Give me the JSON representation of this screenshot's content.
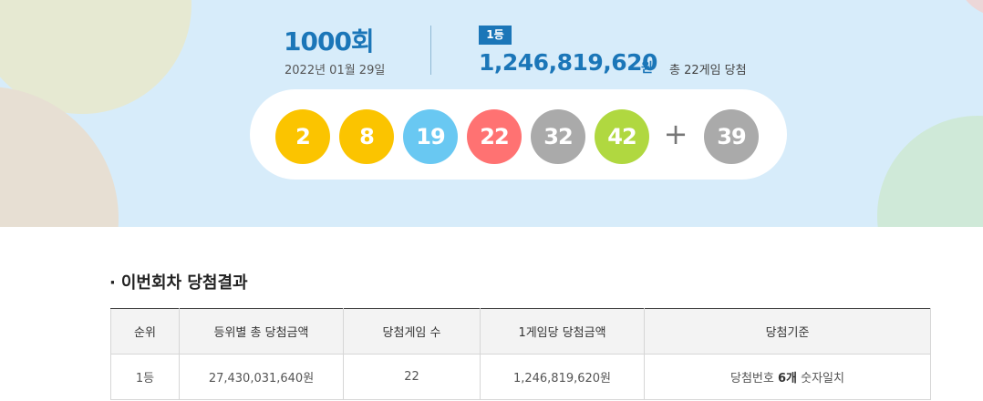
{
  "draw": {
    "round": "1000회",
    "date": "2022년 01월 29일",
    "rank_badge": "1등",
    "first_prize": "1,246,819,620",
    "first_prize_unit": "원",
    "winners_text": "총 22게임 당첨",
    "balls": [
      {
        "number": "2",
        "color": "#fbc400"
      },
      {
        "number": "8",
        "color": "#fbc400"
      },
      {
        "number": "19",
        "color": "#69c8f2"
      },
      {
        "number": "22",
        "color": "#ff7272"
      },
      {
        "number": "32",
        "color": "#aaaaaa"
      },
      {
        "number": "42",
        "color": "#b0d840"
      }
    ],
    "plus": "+",
    "bonus": {
      "number": "39",
      "color": "#aaaaaa"
    }
  },
  "results": {
    "bullet": "·",
    "title": "이번회차 당첨결과",
    "headers": [
      "순위",
      "등위별 총 당첨금액",
      "당첨게임 수",
      "1게임당 당첨금액",
      "당첨기준"
    ],
    "rows": [
      {
        "rank": "1등",
        "total": "27,430,031,640원",
        "games": "22",
        "per_game": "1,246,819,620원",
        "criteria_prefix": "당첨번호 ",
        "criteria_bold": "6개",
        "criteria_suffix": " 숫자일치"
      }
    ]
  }
}
